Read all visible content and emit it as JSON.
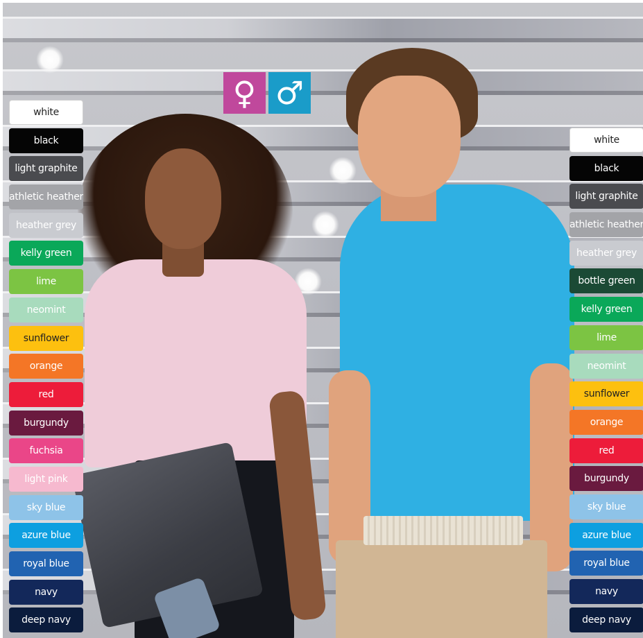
{
  "gender_icons": {
    "female": {
      "glyph": "♀",
      "color": "#c0489c",
      "icon": "female-symbol-icon"
    },
    "male": {
      "glyph": "♂",
      "color": "#1a9cc9",
      "icon": "male-symbol-icon"
    }
  },
  "women_colors": [
    {
      "label": "white",
      "bg": "#ffffff",
      "fg": "#222222",
      "border": "#d0d0d0"
    },
    {
      "label": "black",
      "bg": "#050505",
      "fg": "#ffffff"
    },
    {
      "label": "light graphite",
      "bg": "#4a4b4f",
      "fg": "#ffffff"
    },
    {
      "label": "athletic heather",
      "bg": "#a3a4a8",
      "fg": "#ffffff"
    },
    {
      "label": "heather grey",
      "bg": "#c9cbd0",
      "fg": "#ffffff"
    },
    {
      "label": "kelly green",
      "bg": "#0aa859",
      "fg": "#ffffff"
    },
    {
      "label": "lime",
      "bg": "#7cc443",
      "fg": "#ffffff"
    },
    {
      "label": "neomint",
      "bg": "#a8dbbd",
      "fg": "#ffffff"
    },
    {
      "label": "sunflower",
      "bg": "#fdc00f",
      "fg": "#222222"
    },
    {
      "label": "orange",
      "bg": "#f47626",
      "fg": "#ffffff"
    },
    {
      "label": "red",
      "bg": "#ed1c3a",
      "fg": "#ffffff"
    },
    {
      "label": "burgundy",
      "bg": "#6a1a3f",
      "fg": "#ffffff"
    },
    {
      "label": "fuchsia",
      "bg": "#ea4688",
      "fg": "#ffffff"
    },
    {
      "label": "light pink",
      "bg": "#f6b9cf",
      "fg": "#ffffff"
    },
    {
      "label": "sky blue",
      "bg": "#8ec3e8",
      "fg": "#ffffff"
    },
    {
      "label": "azure blue",
      "bg": "#0d9fe0",
      "fg": "#ffffff"
    },
    {
      "label": "royal blue",
      "bg": "#2163b1",
      "fg": "#ffffff"
    },
    {
      "label": "navy",
      "bg": "#13285a",
      "fg": "#ffffff"
    },
    {
      "label": "deep navy",
      "bg": "#0b1c3d",
      "fg": "#ffffff"
    }
  ],
  "men_colors": [
    {
      "label": "white",
      "bg": "#ffffff",
      "fg": "#222222",
      "border": "#d0d0d0"
    },
    {
      "label": "black",
      "bg": "#050505",
      "fg": "#ffffff"
    },
    {
      "label": "light graphite",
      "bg": "#4a4b4f",
      "fg": "#ffffff"
    },
    {
      "label": "athletic heather",
      "bg": "#a3a4a8",
      "fg": "#ffffff"
    },
    {
      "label": "heather grey",
      "bg": "#c9cbd0",
      "fg": "#ffffff"
    },
    {
      "label": "bottle green",
      "bg": "#1b4a35",
      "fg": "#ffffff"
    },
    {
      "label": "kelly green",
      "bg": "#0aa859",
      "fg": "#ffffff"
    },
    {
      "label": "lime",
      "bg": "#7cc443",
      "fg": "#ffffff"
    },
    {
      "label": "neomint",
      "bg": "#a8dbbd",
      "fg": "#ffffff"
    },
    {
      "label": "sunflower",
      "bg": "#fdc00f",
      "fg": "#222222"
    },
    {
      "label": "orange",
      "bg": "#f47626",
      "fg": "#ffffff"
    },
    {
      "label": "red",
      "bg": "#ed1c3a",
      "fg": "#ffffff"
    },
    {
      "label": "burgundy",
      "bg": "#6a1a3f",
      "fg": "#ffffff"
    },
    {
      "label": "sky blue",
      "bg": "#8ec3e8",
      "fg": "#ffffff"
    },
    {
      "label": "azure blue",
      "bg": "#0d9fe0",
      "fg": "#ffffff"
    },
    {
      "label": "royal blue",
      "bg": "#2163b1",
      "fg": "#ffffff"
    },
    {
      "label": "navy",
      "bg": "#13285a",
      "fg": "#ffffff"
    },
    {
      "label": "deep navy",
      "bg": "#0b1c3d",
      "fg": "#ffffff"
    }
  ]
}
